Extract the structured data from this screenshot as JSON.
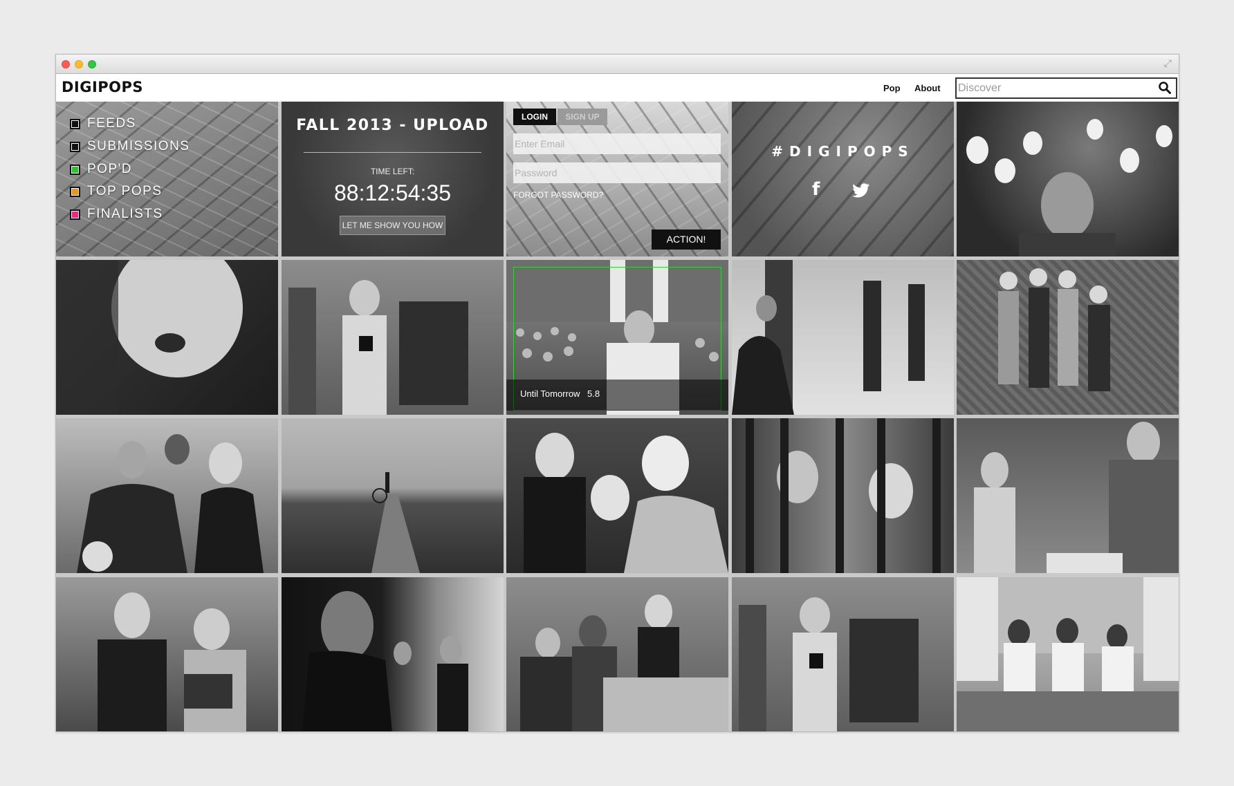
{
  "navbar": {
    "logo": "DIGIPOPS",
    "links": [
      "Pop",
      "About"
    ],
    "search_placeholder": "Discover"
  },
  "menu": {
    "items": [
      {
        "label": "FEEDS",
        "color": "#111111"
      },
      {
        "label": "SUBMISSIONS",
        "color": "#111111"
      },
      {
        "label": "POP'D",
        "color": "#2fbf2f"
      },
      {
        "label": "TOP POPS",
        "color": "#e8951c"
      },
      {
        "label": "FINALISTS",
        "color": "#e0307a"
      }
    ]
  },
  "upload": {
    "title": "FALL 2013 - UPLOAD",
    "time_left_label": "TIME LEFT:",
    "timer": "88:12:54:35",
    "button": "LET ME SHOW YOU HOW"
  },
  "login": {
    "tab_login": "LOGIN",
    "tab_signup": "SIGN UP",
    "email_placeholder": "Enter Email",
    "password_placeholder": "Password",
    "forgot": "FORGOT PASSWORD?",
    "action": "ACTION!"
  },
  "social": {
    "hashtag": "#DIGIPOPS",
    "icons": [
      "facebook-icon",
      "twitter-icon"
    ]
  },
  "featured": {
    "title": "Until Tomorrow",
    "score": "5.8"
  },
  "colors": {
    "accent_green": "#2fd62f",
    "dark": "#111111"
  }
}
